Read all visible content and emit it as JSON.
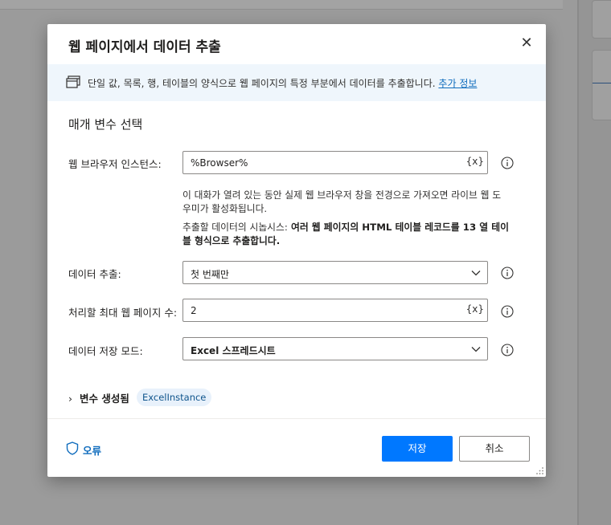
{
  "dialog": {
    "title": "웹 페이지에서 데이터 추출",
    "info_text": "단일 값, 목록, 행, 테이블의 양식으로 웹 페이지의 특정 부분에서 데이터를 추출합니다.",
    "info_link": "추가 정보",
    "section_title": "매개 변수 선택",
    "browser": {
      "label": "웹 브라우저 인스턴스:",
      "value": "%Browser%",
      "var_button": "{x}"
    },
    "note1_line1": "이 대화가 열려 있는 동안 실제 웹 브라우저 창을 전경으로 가져오면 라이브 웹 도",
    "note1_line2": "우미가 활성화됩니다.",
    "note2_prefix": "추출할 데이터의 시놉시스:",
    "note2_bold_line1": " 여러 웹 페이지의 HTML 테이블 레코드를 13 열 테이",
    "note2_bold_line2": "블 형식으로 추출합니다.",
    "extract": {
      "label": "데이터 추출:",
      "value": "첫 번째만"
    },
    "max_pages": {
      "label": "처리할 최대 웹 페이지 수:",
      "value": "2",
      "var_button": "{x}"
    },
    "save_mode": {
      "label": "데이터 저장 모드:",
      "value": "Excel 스프레드시트"
    },
    "vars_generated": "변수 생성됨",
    "var_pill": "ExcelInstance",
    "error_label": "오류",
    "save_button": "저장",
    "cancel_button": "취소"
  },
  "colors": {
    "accent": "#0078ff",
    "link": "#0f6cbd",
    "info_bg": "#eff6fc",
    "pill_bg": "#e8f1fb"
  }
}
